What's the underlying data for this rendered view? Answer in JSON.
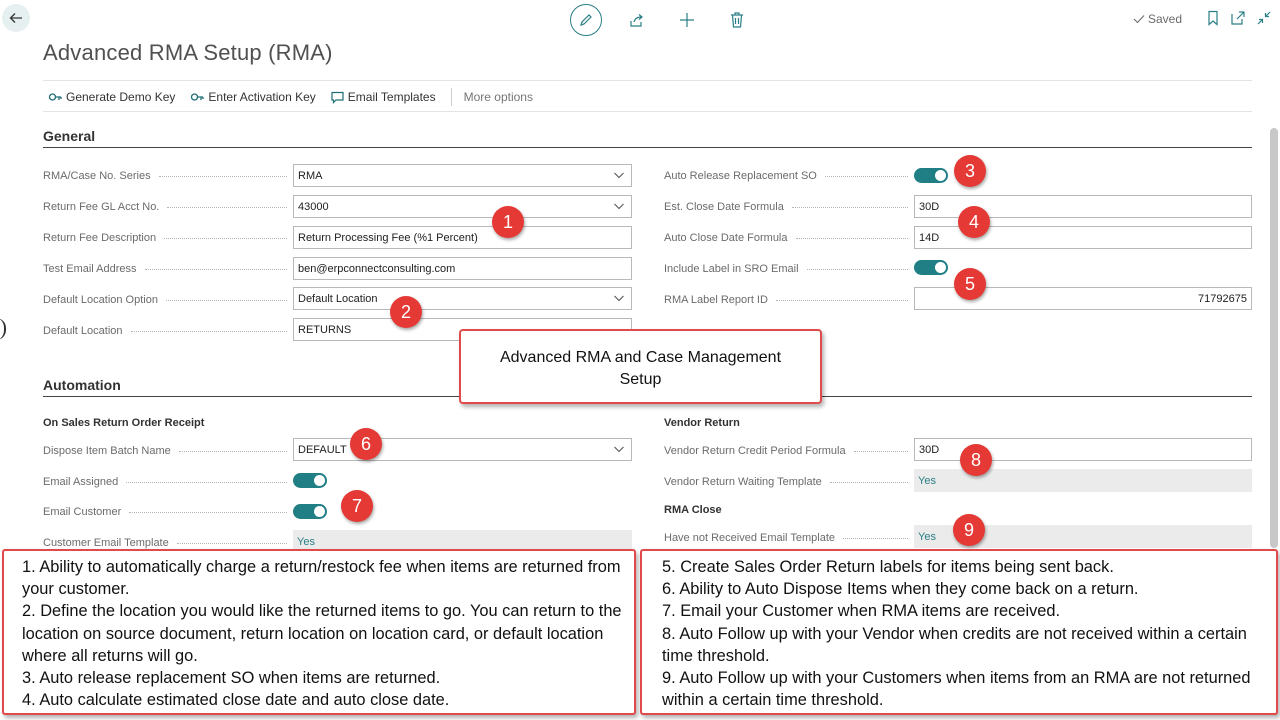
{
  "header": {
    "saved_label": "Saved",
    "title": "Advanced RMA Setup (RMA)"
  },
  "actions": {
    "generate_demo_key": "Generate Demo Key",
    "enter_activation_key": "Enter Activation Key",
    "email_templates": "Email Templates",
    "more_options": "More options"
  },
  "general": {
    "title": "General",
    "rma_case_no_series": {
      "label": "RMA/Case No. Series",
      "value": "RMA"
    },
    "return_fee_gl_acct_no": {
      "label": "Return Fee GL Acct No.",
      "value": "43000"
    },
    "return_fee_description": {
      "label": "Return Fee Description",
      "value": "Return Processing Fee (%1 Percent)"
    },
    "test_email_address": {
      "label": "Test Email Address",
      "value": "ben@erpconnectconsulting.com"
    },
    "default_location_option": {
      "label": "Default Location Option",
      "value": "Default Location"
    },
    "default_location": {
      "label": "Default Location",
      "value": "RETURNS"
    },
    "auto_release_replacement_so": {
      "label": "Auto Release Replacement SO",
      "value": true
    },
    "est_close_date_formula": {
      "label": "Est. Close Date Formula",
      "value": "30D"
    },
    "auto_close_date_formula": {
      "label": "Auto Close Date Formula",
      "value": "14D"
    },
    "include_label_in_sro_email": {
      "label": "Include Label in SRO Email",
      "value": true
    },
    "rma_label_report_id": {
      "label": "RMA Label Report ID",
      "value": "71792675"
    }
  },
  "automation": {
    "title": "Automation",
    "on_sales_return_order_receipt": "On Sales Return Order Receipt",
    "dispose_item_batch_name": {
      "label": "Dispose Item Batch Name",
      "value": "DEFAULT"
    },
    "email_assigned": {
      "label": "Email Assigned",
      "value": true
    },
    "email_customer": {
      "label": "Email Customer",
      "value": true
    },
    "customer_email_template": {
      "label": "Customer Email Template",
      "value": "Yes"
    },
    "vendor_return": "Vendor Return",
    "vendor_return_credit_period_formula": {
      "label": "Vendor Return Credit Period Formula",
      "value": "30D"
    },
    "vendor_return_waiting_template": {
      "label": "Vendor Return Waiting Template",
      "value": "Yes"
    },
    "rma_close": "RMA Close",
    "have_not_received_email_template": {
      "label": "Have not Received Email Template",
      "value": "Yes"
    }
  },
  "badges": [
    "1",
    "2",
    "3",
    "4",
    "5",
    "6",
    "7",
    "8",
    "9"
  ],
  "callout": {
    "line1": "Advanced RMA and Case Management",
    "line2": "Setup"
  },
  "notes_left": [
    "1. Ability to automatically charge a return/restock fee when items are returned from your customer.",
    "2. Define the location you would like the returned items to go. You can return to the location on source document, return location on location card, or default location where all returns will go.",
    "3. Auto release replacement SO when items are returned.",
    "4. Auto calculate estimated close date and auto close date."
  ],
  "notes_right": [
    "5. Create Sales Order Return labels for items being sent back.",
    "6. Ability to Auto Dispose Items when they come back on a return.",
    "7. Email your Customer when RMA items are received.",
    "8. Auto Follow up with your Vendor when credits are not received within a certain time threshold.",
    "9. Auto Follow up with your Customers when items from an RMA are not returned within a certain time threshold."
  ],
  "colors": {
    "accent": "#1f7f85",
    "badge": "#e53935",
    "callout_border": "#e04a4a"
  }
}
